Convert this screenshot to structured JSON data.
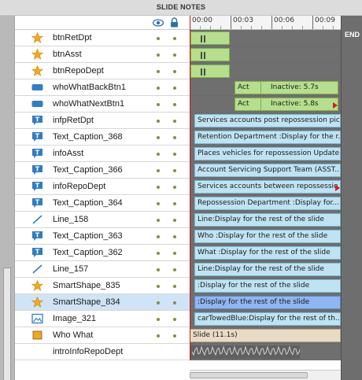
{
  "panel": {
    "title": "SLIDE NOTES"
  },
  "ruler": {
    "labels": [
      "00:00",
      "00:03",
      "00:06",
      "00:09"
    ]
  },
  "end_label": "END",
  "colors": {
    "star": "#f2a81d",
    "button_blue": "#2f7fc7",
    "caption_blue": "#2d7cc6",
    "playhead": "#dd1111",
    "green_bar": "#b5df8c",
    "blue_bar": "#bfe3f3",
    "selected_bar": "#8fb6f0"
  },
  "layers": [
    {
      "name": "btnRetDpt",
      "icon": "star-icon",
      "bar": {
        "type": "green-play"
      }
    },
    {
      "name": "btnAsst",
      "icon": "star-icon",
      "bar": {
        "type": "green-play"
      }
    },
    {
      "name": "btnRepoDept",
      "icon": "star-icon",
      "bar": {
        "type": "green-play"
      }
    },
    {
      "name": "whoWhatBackBtn1",
      "icon": "button-icon",
      "bar": {
        "type": "green-act",
        "act": "Act",
        "inactive": "Inactive: 5.7s"
      }
    },
    {
      "name": "whoWhatNextBtn1",
      "icon": "button-icon",
      "bar": {
        "type": "green-act",
        "act": "Act",
        "inactive": "Inactive: 5.8s",
        "arrow": true
      }
    },
    {
      "name": "infpRetDpt",
      "icon": "caption-icon",
      "bar": {
        "type": "blue",
        "text": "Services accounts post repossession pic..."
      }
    },
    {
      "name": "Text_Caption_368",
      "icon": "caption-icon",
      "bar": {
        "type": "blue",
        "text": "Retention Department :Display for the r..."
      }
    },
    {
      "name": "infoAsst",
      "icon": "caption-icon",
      "bar": {
        "type": "blue",
        "text": "Places vehicles for repossession Update..."
      }
    },
    {
      "name": "Text_Caption_366",
      "icon": "caption-icon",
      "bar": {
        "type": "blue",
        "text": "Account Servicing  Support Team (ASST..."
      }
    },
    {
      "name": "infoRepoDept",
      "icon": "caption-icon",
      "bar": {
        "type": "blue",
        "text": "Services accounts between repossessio...",
        "arrow": true
      }
    },
    {
      "name": "Text_Caption_364",
      "icon": "caption-icon",
      "bar": {
        "type": "blue",
        "text": "Repossession  Department  :Display for..."
      }
    },
    {
      "name": "Line_158",
      "icon": "line-icon",
      "bar": {
        "type": "blue",
        "text": "Line:Display for the rest of the slide"
      }
    },
    {
      "name": "Text_Caption_363",
      "icon": "caption-icon",
      "bar": {
        "type": "blue",
        "text": "Who :Display for the rest of the slide"
      }
    },
    {
      "name": "Text_Caption_362",
      "icon": "caption-icon",
      "bar": {
        "type": "blue",
        "text": "What :Display for the rest of the slide"
      }
    },
    {
      "name": "Line_157",
      "icon": "line-icon",
      "bar": {
        "type": "blue",
        "text": "Line:Display for the rest of the slide"
      }
    },
    {
      "name": "SmartShape_835",
      "icon": "star-icon",
      "bar": {
        "type": "blue",
        "text": " :Display for the rest of the slide"
      }
    },
    {
      "name": "SmartShape_834",
      "icon": "star-icon",
      "selected": true,
      "bar": {
        "type": "blue-sel",
        "text": " :Display for the rest of the slide"
      }
    },
    {
      "name": "Image_321",
      "icon": "image-icon",
      "bar": {
        "type": "blue",
        "text": "carTowedBlue:Display for the rest of th..."
      }
    },
    {
      "name": "Who What",
      "icon": "slide-icon",
      "bar": {
        "type": "tan",
        "text": "Slide (11.1s)"
      }
    },
    {
      "name": "introInfoRepoDept",
      "icon": "",
      "bar": {
        "type": "audio"
      }
    }
  ]
}
